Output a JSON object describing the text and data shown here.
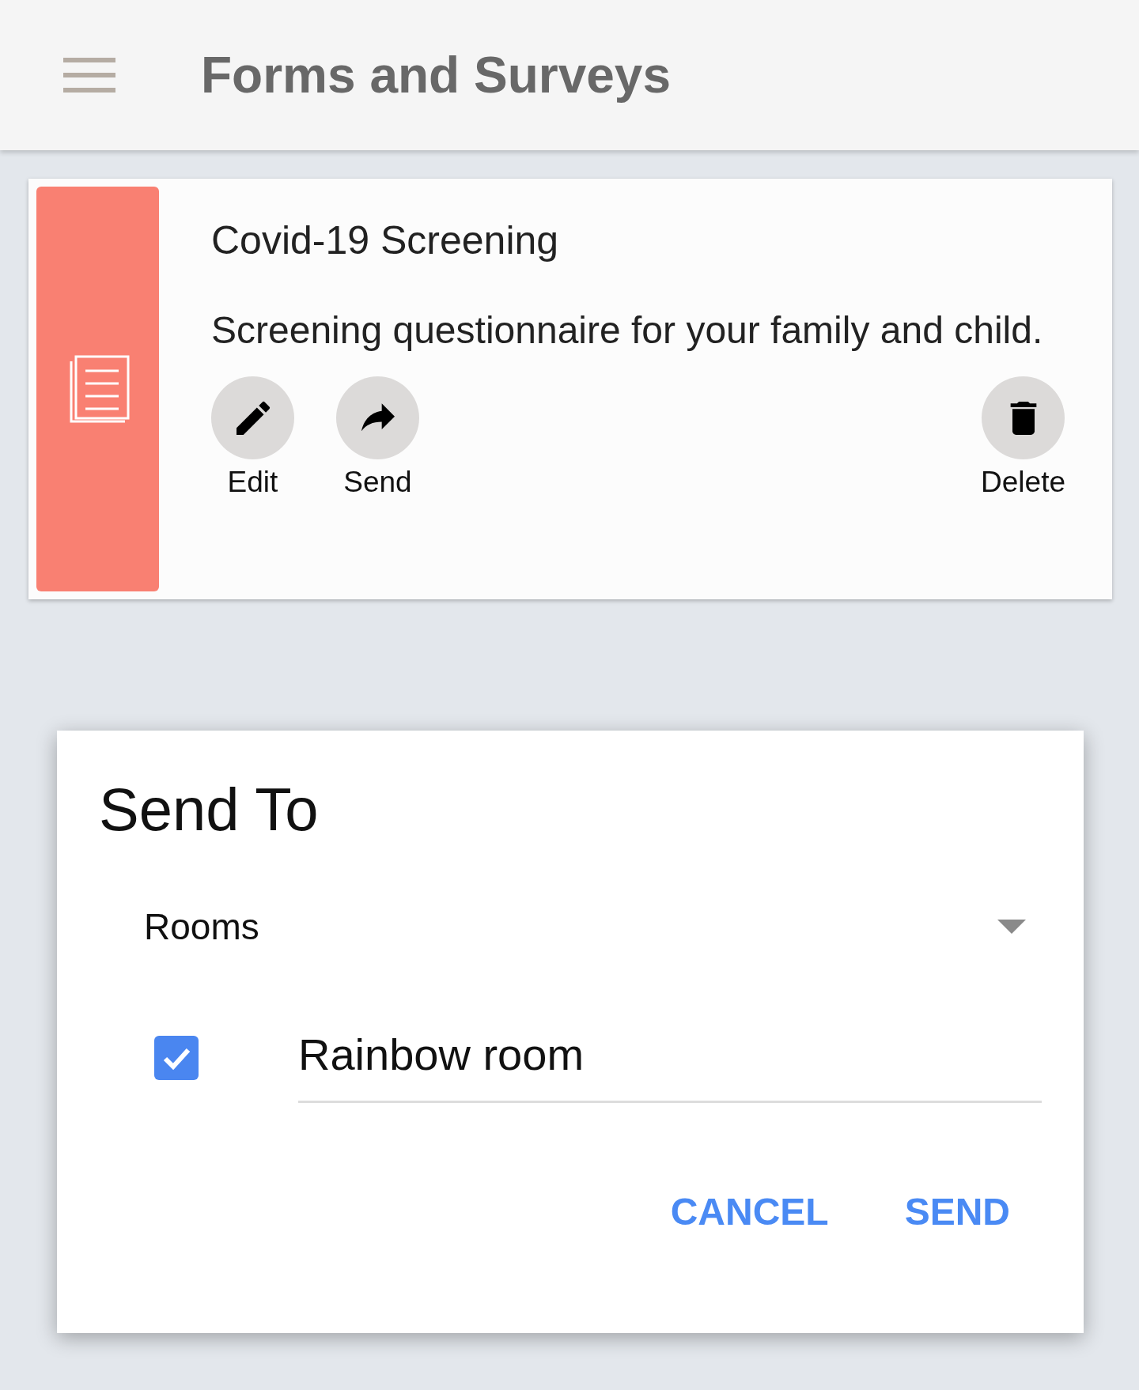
{
  "app_bar": {
    "title": "Forms and Surveys"
  },
  "form_card": {
    "title": "Covid-19 Screening",
    "description": "Screening questionnaire for your family and child.",
    "actions": [
      {
        "kind": "edit",
        "label": "Edit"
      },
      {
        "kind": "send",
        "label": "Send"
      },
      {
        "kind": "delete",
        "label": "Delete"
      }
    ]
  },
  "dialog": {
    "title": "Send To",
    "select": {
      "value": "Rooms"
    },
    "options": [
      {
        "label": "Rainbow room",
        "checked": true
      }
    ],
    "buttons": [
      "CANCEL",
      "SEND"
    ]
  }
}
